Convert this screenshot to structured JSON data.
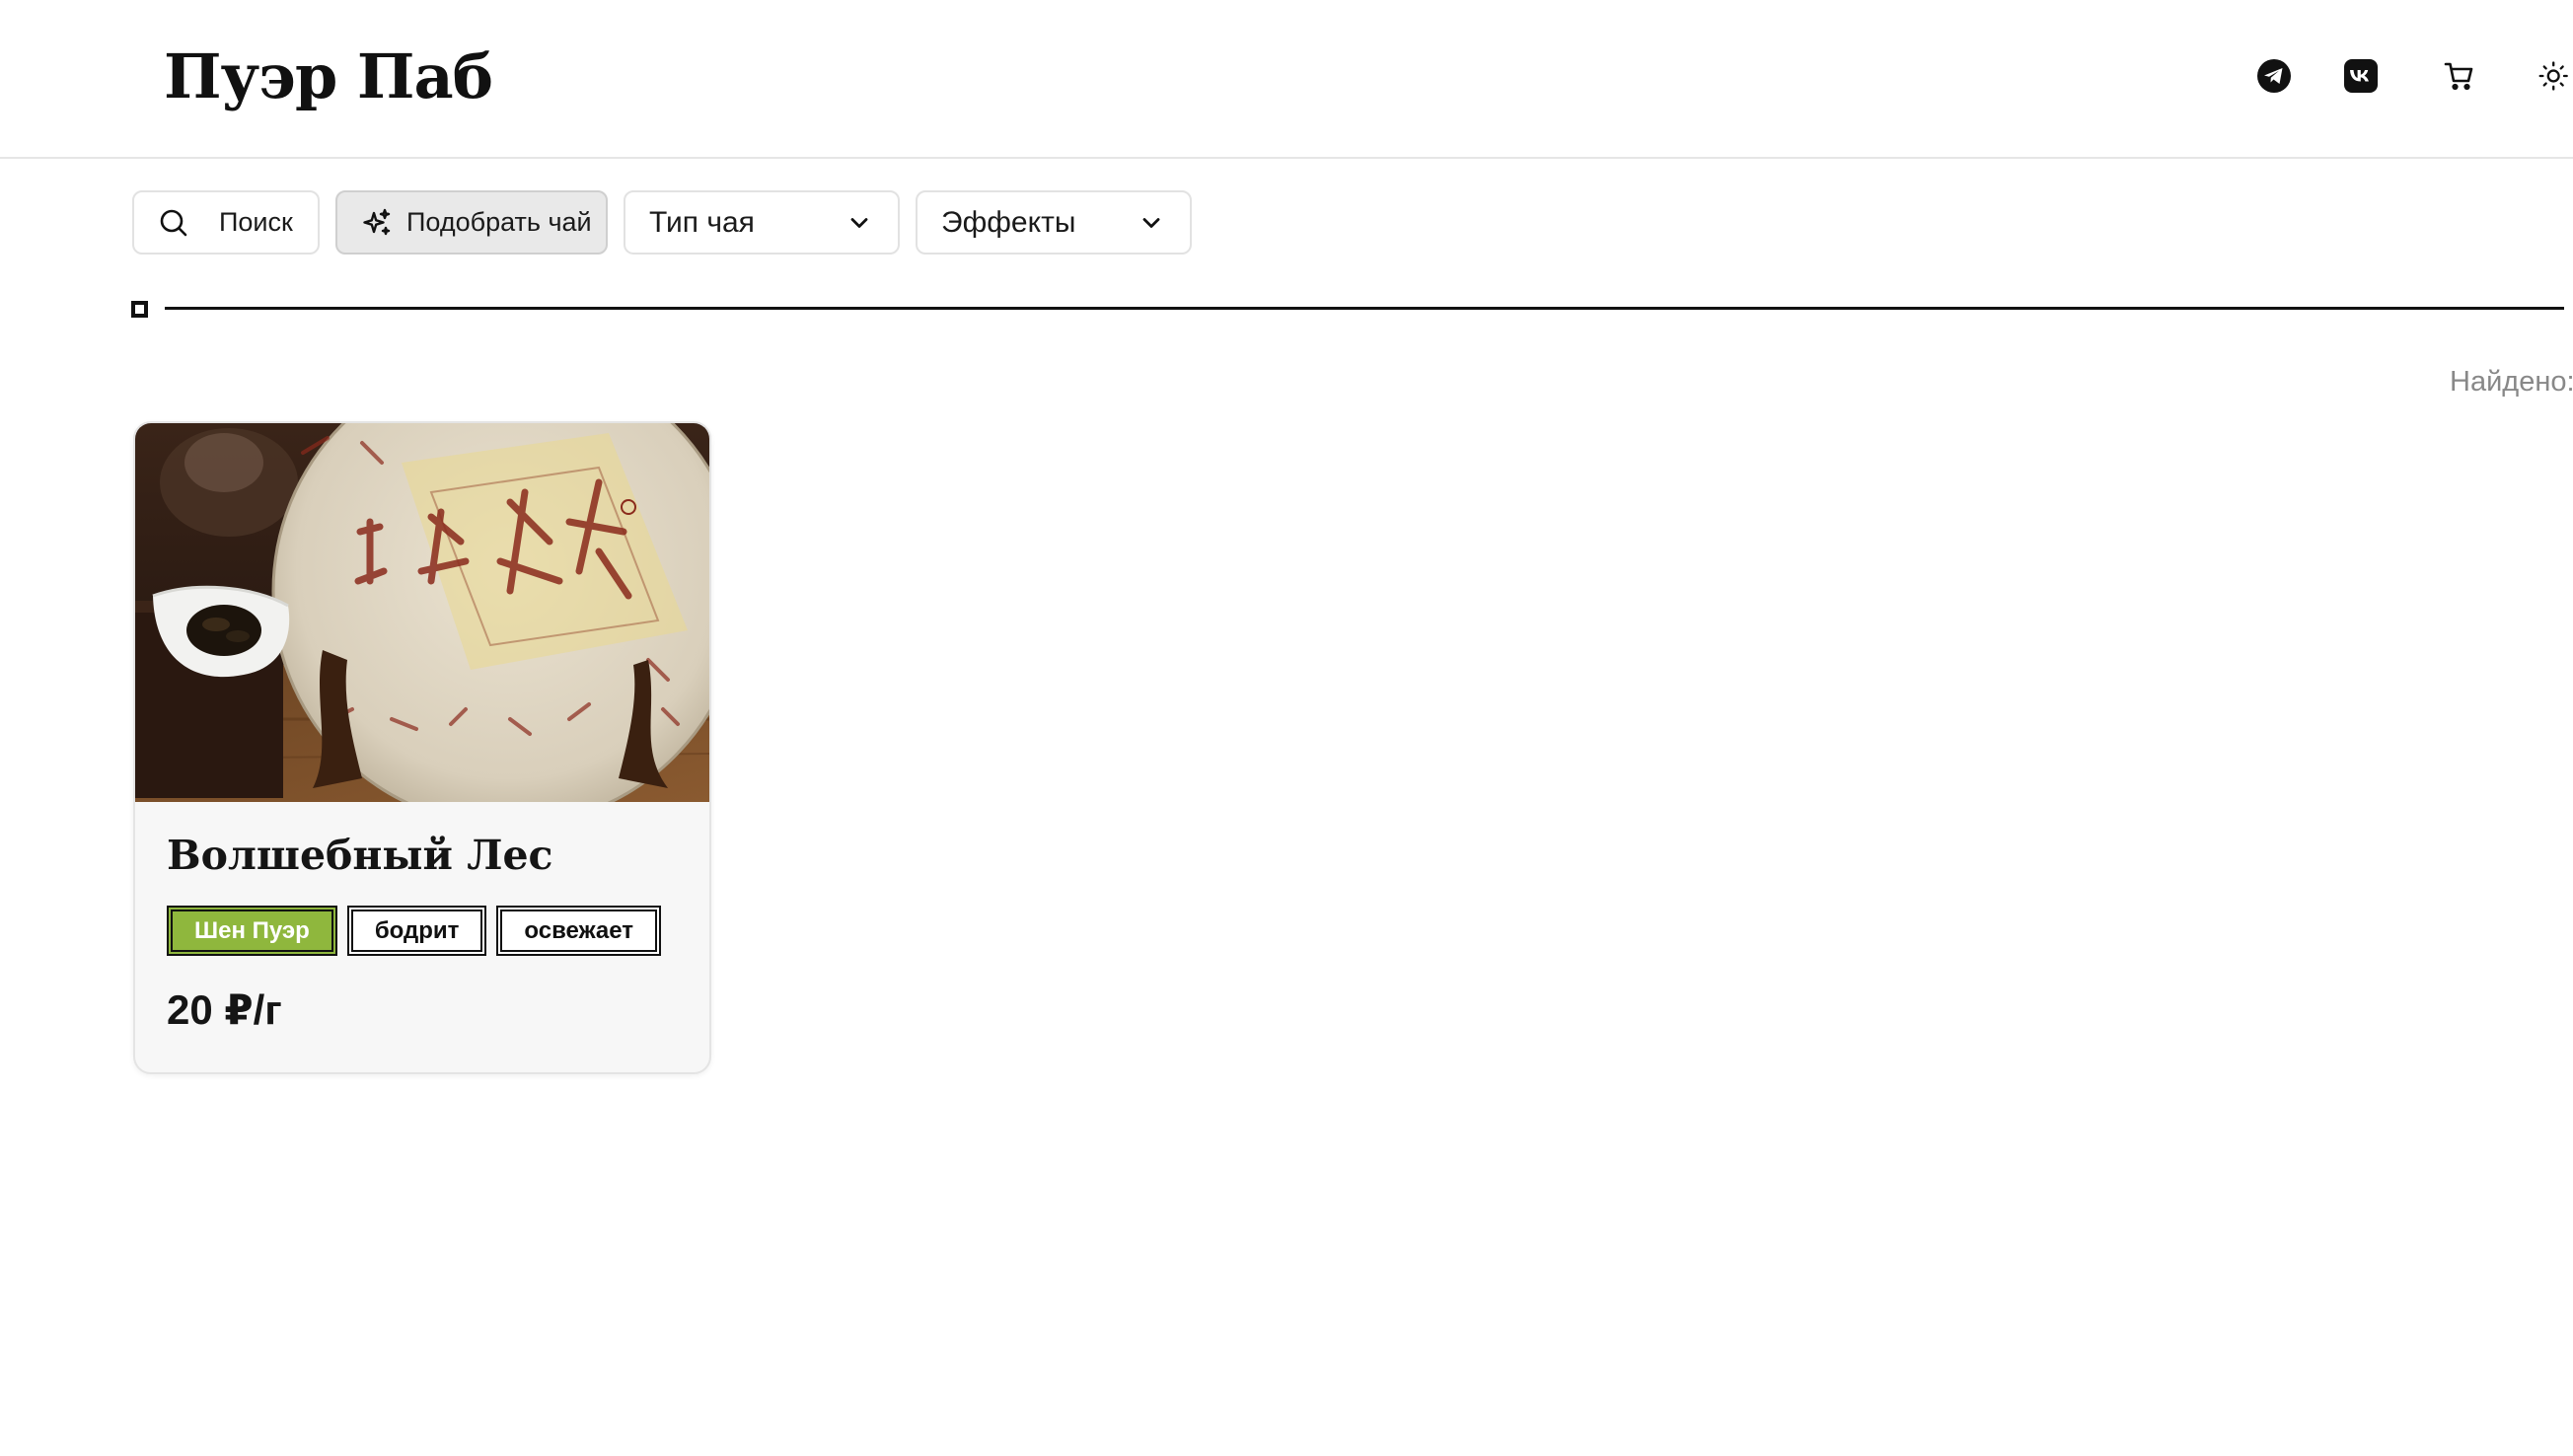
{
  "header": {
    "logo": "Пуэр Паб",
    "icons": [
      "telegram-icon",
      "vk-icon",
      "cart-icon",
      "theme-sun-icon"
    ]
  },
  "toolbar": {
    "search_label": "Поиск",
    "pick_tea_label": "Подобрать чай",
    "tea_type_label": "Тип чая",
    "effects_label": "Эффекты"
  },
  "results": {
    "found_label": "Найдено:"
  },
  "products": [
    {
      "title": "Волшебный Лес",
      "tags": [
        "Шен Пуэр",
        "бодрит",
        "освежает"
      ],
      "price": "20 ₽/г"
    }
  ],
  "colors": {
    "accent_tag": "#8fb73d",
    "text": "#111111",
    "muted": "#888888",
    "border": "#e2e2e2"
  }
}
